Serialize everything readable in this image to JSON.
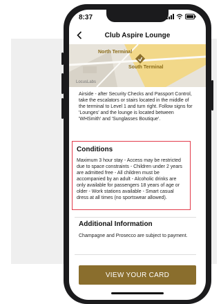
{
  "status_bar": {
    "time": "8:37"
  },
  "nav": {
    "title": "Club Aspire Lounge"
  },
  "map": {
    "north_label": "North Terminal",
    "south_label": "South Terminal",
    "logo_text": "LocusLabs"
  },
  "directions": "Airside - after Security Checks and Passport Control, take the escalators or stairs located in the middle of the terminal to Level 1 and turn right. Follow signs for 'Lounges' and the lounge is located between 'WHSmith' and 'Sunglasses Boutique'.",
  "conditions": {
    "title": "Conditions",
    "text": "Maximum 3 hour stay - Access may be restricted due to space constraints - Children under 2 years are admitted free - All children must be accompanied by an adult - Alcoholic drinks are only available for passengers 18 years of age or older - Work stations available - Smart casual dress at all times (no sportswear allowed)."
  },
  "additional_info": {
    "title": "Additional Information",
    "text": "Champagne and Prosecco are subject to payment."
  },
  "cta": {
    "label": "VIEW YOUR CARD"
  },
  "colors": {
    "accent_gold": "#8a6e2d",
    "highlight_red": "#e23a4a"
  }
}
